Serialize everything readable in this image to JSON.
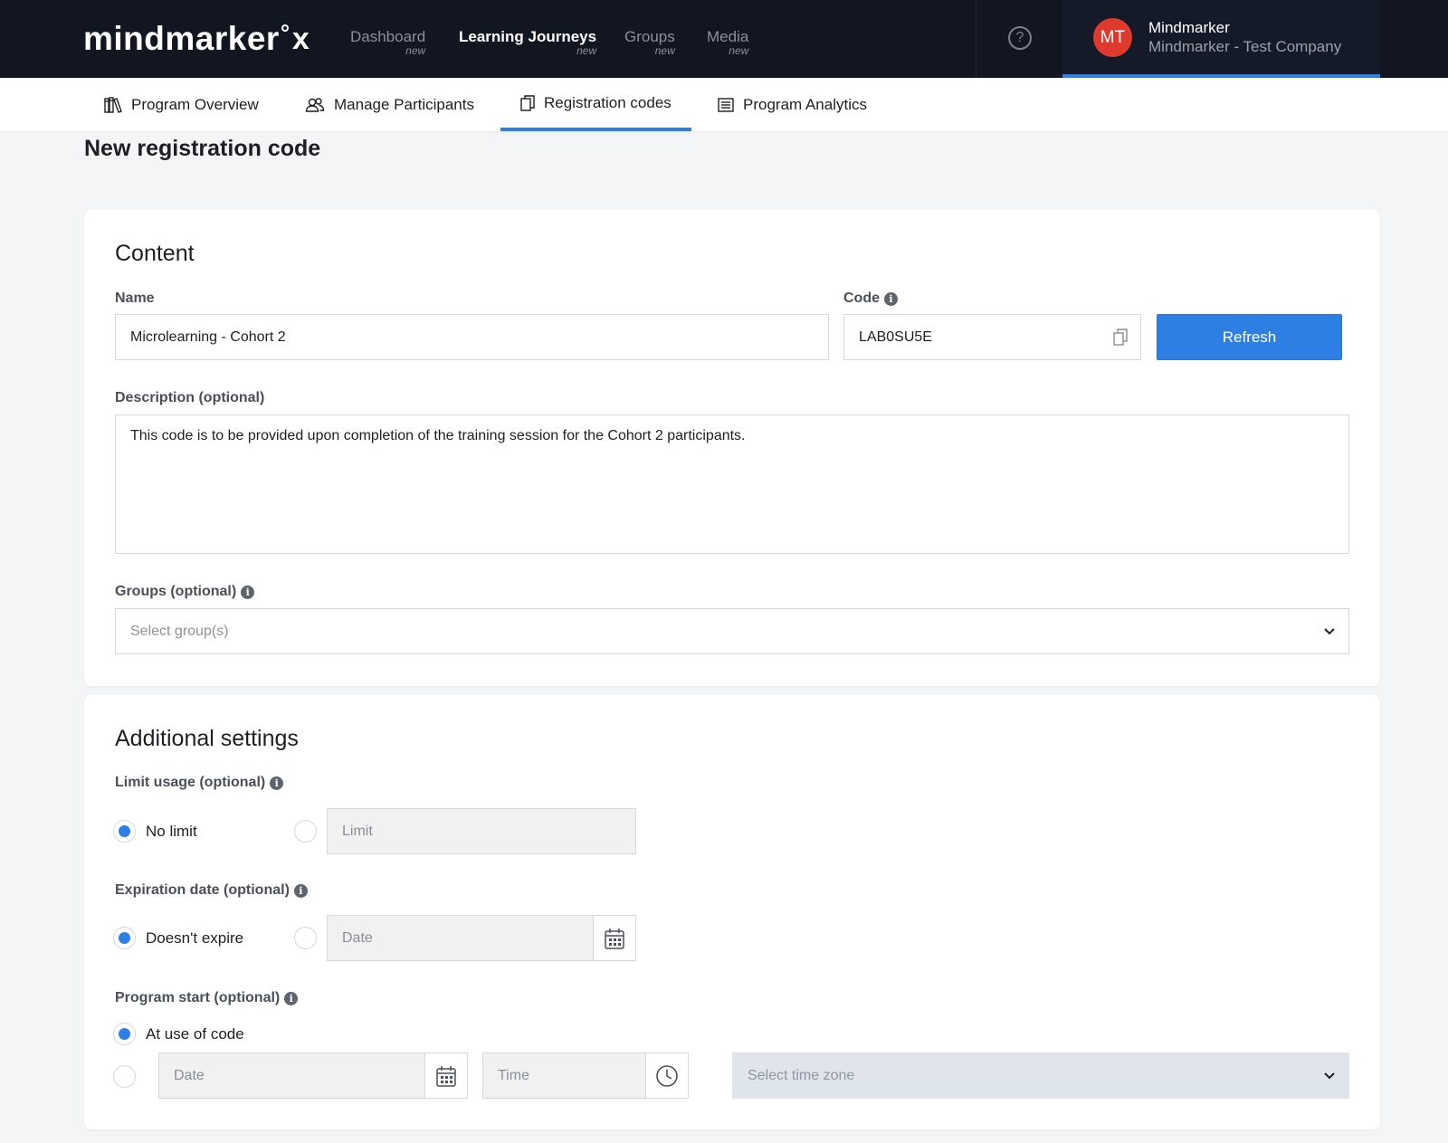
{
  "brand": {
    "logo_text": "mindmarker",
    "logo_mark": "x"
  },
  "nav": [
    {
      "label": "Dashboard",
      "sub": "new"
    },
    {
      "label": "Learning Journeys",
      "sub": "new"
    },
    {
      "label": "Groups",
      "sub": "new"
    },
    {
      "label": "Media",
      "sub": "new"
    }
  ],
  "help": {
    "glyph": "?"
  },
  "user": {
    "initials": "MT",
    "name": "Mindmarker",
    "company": "Mindmarker - Test Company"
  },
  "subnav": [
    {
      "label": "Program Overview",
      "icon": "books-icon"
    },
    {
      "label": "Manage Participants",
      "icon": "users-icon"
    },
    {
      "label": "Registration codes",
      "icon": "copy-icon"
    },
    {
      "label": "Program Analytics",
      "icon": "list-icon"
    }
  ],
  "page": {
    "title": "New registration code"
  },
  "content": {
    "title": "Content",
    "name_label": "Name",
    "name_value": "Microlearning - Cohort 2",
    "code_label": "Code",
    "code_value": "LAB0SU5E",
    "refresh_label": "Refresh",
    "description_label": "Description (optional)",
    "description_value": "This code is to be provided upon completion of the training session for the Cohort 2 participants.",
    "groups_label": "Groups (optional)",
    "groups_placeholder": "Select group(s)"
  },
  "additional": {
    "title": "Additional settings",
    "limit_label": "Limit usage (optional)",
    "no_limit_label": "No limit",
    "limit_placeholder": "Limit",
    "expiration_label": "Expiration date (optional)",
    "doesnt_expire_label": "Doesn't expire",
    "date_placeholder": "Date",
    "program_start_label": "Program start (optional)",
    "at_use_label": "At use of code",
    "start_date_placeholder": "Date",
    "time_placeholder": "Time",
    "timezone_placeholder": "Select time zone"
  },
  "colors": {
    "accent": "#2e7fe3",
    "topbar": "#121620",
    "avatar": "#e03a2f"
  }
}
